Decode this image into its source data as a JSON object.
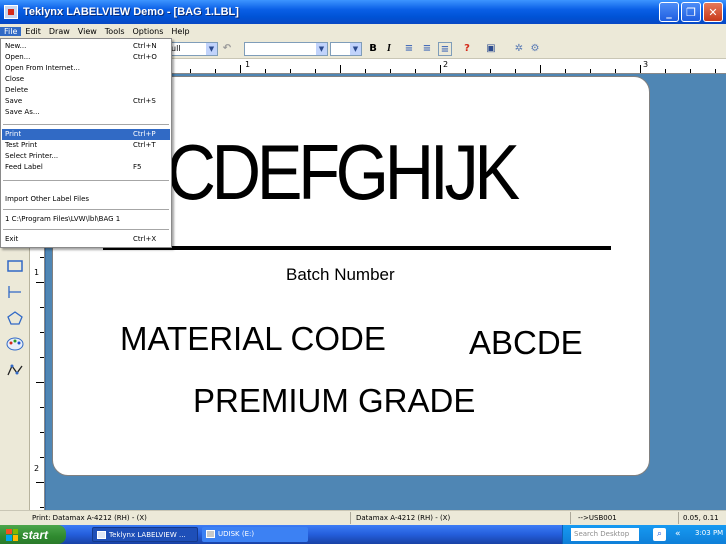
{
  "window": {
    "title": "Teklynx LABELVIEW Demo - [BAG 1.LBL]"
  },
  "menubar": [
    "File",
    "Edit",
    "Draw",
    "View",
    "Tools",
    "Options",
    "Help"
  ],
  "file_menu": {
    "items": [
      {
        "label": "New...",
        "shortcut": "Ctrl+N"
      },
      {
        "label": "Open...",
        "shortcut": "Ctrl+O"
      },
      {
        "label": "Open From Internet...",
        "shortcut": ""
      },
      {
        "label": "Close",
        "shortcut": ""
      },
      {
        "label": "Delete",
        "shortcut": ""
      },
      {
        "label": "Save",
        "shortcut": "Ctrl+S"
      },
      {
        "label": "Save As...",
        "shortcut": ""
      },
      {
        "label": "Print",
        "shortcut": "Ctrl+P"
      },
      {
        "label": "Test Print",
        "shortcut": "Ctrl+T"
      },
      {
        "label": "Select Printer...",
        "shortcut": ""
      },
      {
        "label": "Feed Label",
        "shortcut": "F5"
      },
      {
        "label": "Import Other Label Files",
        "shortcut": ""
      },
      {
        "label": "1 C:\\Program Files\\LVW\\lbl\\BAG 1",
        "shortcut": ""
      },
      {
        "label": "Exit",
        "shortcut": "Ctrl+X"
      }
    ],
    "highlighted": "Print"
  },
  "toolbar": {
    "zoom_value": "ull",
    "bold": "B",
    "italic": "I",
    "print_glyph": "?"
  },
  "ruler": {
    "top_numbers": [
      "1",
      "2",
      "3"
    ],
    "left_numbers": [
      "1",
      "2"
    ]
  },
  "label": {
    "big_text": "BCDEFGHIJK",
    "batch": "Batch Number",
    "material": "MATERIAL CODE",
    "code": "ABCDE",
    "grade": "PREMIUM GRADE"
  },
  "statusbar": {
    "left": "Print: Datamax A-4212 (RH) - (X)",
    "printer": "Datamax A-4212 (RH) - (X)",
    "port": "-->USB001",
    "coords": "0.05, 0.11"
  },
  "taskbar": {
    "start": "start",
    "tasks": [
      "Teklynx LABELVIEW ...",
      "UDISK (E:)"
    ],
    "search_placeholder": "Search Desktop",
    "clock": "3:03 PM"
  },
  "colors": {
    "workspace": "#4f86b4",
    "highlight": "#316ac5",
    "titlebar": "#0a5fe6"
  }
}
